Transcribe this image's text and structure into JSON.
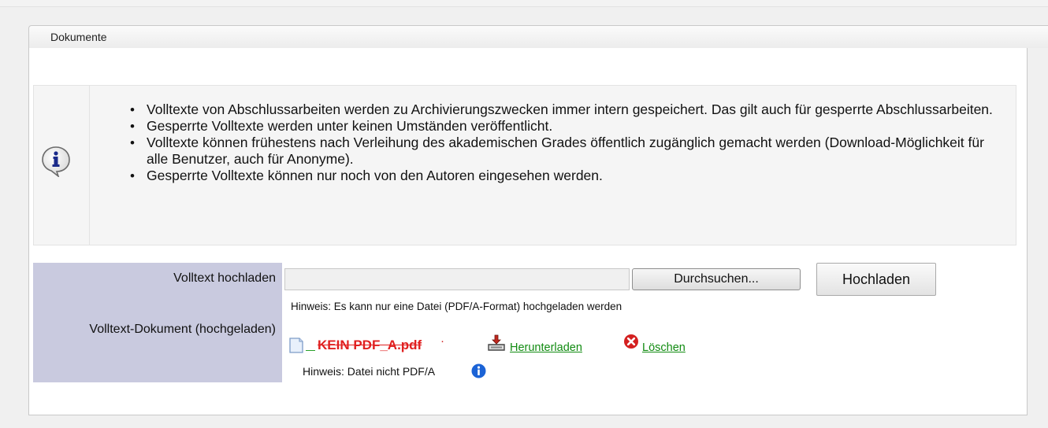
{
  "panel": {
    "title": "Dokumente"
  },
  "info": {
    "icon": "info-speech-bubble-icon",
    "items": [
      "Volltexte von Abschlussarbeiten werden zu Archivierungszwecken immer intern gespeichert. Das gilt auch für gesperrte Abschlussarbeiten.",
      "Gesperrte Volltexte werden unter keinen Umständen veröffentlicht.",
      "Volltexte können frühestens nach Verleihung des akademischen Grades öffentlich zugänglich gemacht werden (Download-Möglichkeit für alle Benutzer, auch für Anonyme).",
      "Gesperrte Volltexte können nur noch von den Autoren eingesehen werden."
    ]
  },
  "upload": {
    "label": "Volltext hochladen",
    "file_value": "",
    "browse_label": "Durchsuchen...",
    "upload_label": "Hochladen",
    "hint": "Hinweis: Es kann nur eine Datei (PDF/A-Format) hochgeladen werden"
  },
  "uploaded": {
    "label": "Volltext-Dokument (hochgeladen)",
    "file_name": "KEIN PDF_A.pdf",
    "separator": "·",
    "download_label": " Herunterladen",
    "delete_label": " Löschen",
    "hint": "Hinweis: Datei nicht PDF/A",
    "colors": {
      "file_name": "#e02020",
      "link": "#118b11",
      "label_bg": "#c9cadf"
    }
  }
}
